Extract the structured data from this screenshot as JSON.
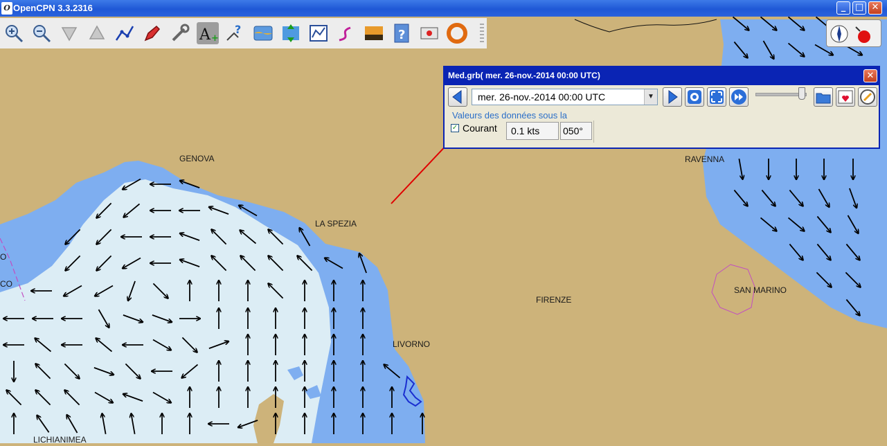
{
  "app": {
    "title": "OpenCPN 3.3.2316",
    "icon_letter": "O"
  },
  "window_controls": {
    "minimize": "_",
    "maximize": "□",
    "close": "✕"
  },
  "toolbar": {
    "buttons": [
      "zoom-in-icon",
      "zoom-out-icon",
      "scale-down-icon",
      "scale-up-icon",
      "route-icon",
      "ship-icon",
      "settings-wrench-icon",
      "text-icon",
      "query-icon",
      "chart-quilt-icon",
      "tide-icon",
      "current-chart-icon",
      "track-icon",
      "colour-scheme-icon",
      "help-icon",
      "print-icon",
      "lifebuoy-icon"
    ]
  },
  "grib": {
    "title": "Med.grb( mer. 26-nov.-2014 00:00  UTC)",
    "close": "✕",
    "time_value": "mer. 26-nov.-2014 00:00  UTC",
    "time_dropdown_arrow": "▼",
    "slider_level": 0.9,
    "caption": "Valeurs des données sous la",
    "courant": {
      "checked": true,
      "check_mark": "✓",
      "label": "Courant",
      "speed": "0.1 kts",
      "direction": "050°"
    }
  },
  "places": [
    "GENOVA",
    "LA SPEZIA",
    "RAVENNA",
    "SAN MARINO",
    "FIRENZE",
    "LIVORNO",
    "LICHIANIMEA",
    "O",
    "CO"
  ],
  "colors": {
    "land": "#cdb37a",
    "shallow_water": "#7eaef0",
    "water": "#aac9ec",
    "deep_water": "#dcedf5",
    "route": "#e00000",
    "grib_frame": "#0a24b4"
  }
}
